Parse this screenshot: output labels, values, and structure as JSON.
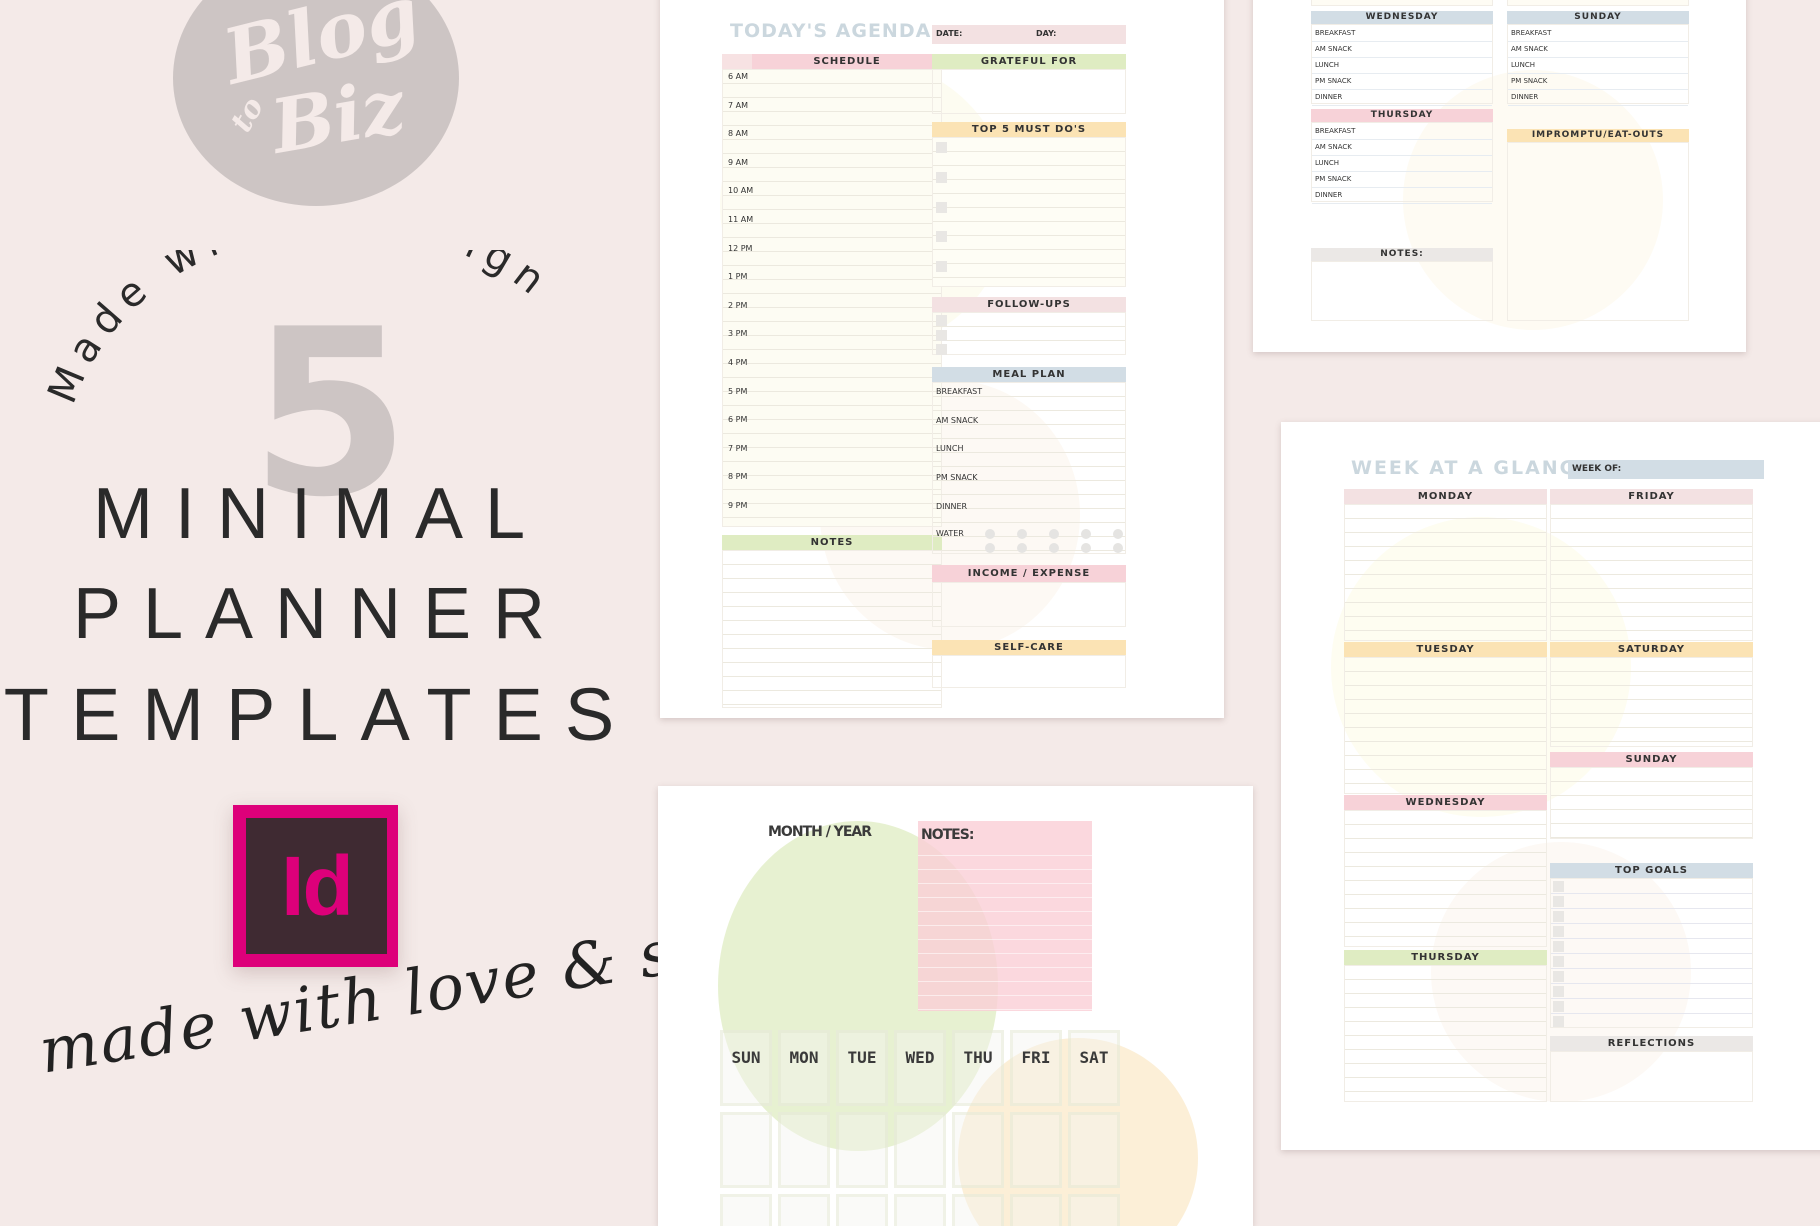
{
  "brand": {
    "logo_line1": "Blog",
    "logo_line2": "to",
    "logo_line3": "Biz"
  },
  "promo": {
    "arc_text": "Made with InDesign",
    "count": "5",
    "headline": [
      "MINIMAL",
      "PLANNER",
      "TEMPLATES"
    ],
    "app_icon_label": "Id",
    "tagline": "made with love & style"
  },
  "colors": {
    "background": "#f4eae8",
    "indesign_magenta": "#dd007a",
    "indesign_dark": "#3f2a32",
    "pink": "#f7d2d8",
    "green": "#dfecc2",
    "orange": "#fbe3b4",
    "blue": "#d2dde5",
    "grey": "#ebe8e6"
  },
  "agenda": {
    "title": "TODAY'S AGENDA",
    "date_label": "DATE:",
    "day_label": "DAY:",
    "schedule_header": "SCHEDULE",
    "times": [
      "6 AM",
      "7 AM",
      "8 AM",
      "9 AM",
      "10 AM",
      "11 AM",
      "12 PM",
      "1 PM",
      "2 PM",
      "3 PM",
      "4 PM",
      "5 PM",
      "6 PM",
      "7 PM",
      "8 PM",
      "9 PM"
    ],
    "notes_header": "NOTES",
    "grateful_header": "GRATEFUL FOR",
    "top5_header": "TOP 5 MUST DO'S",
    "followups_header": "FOLLOW-UPS",
    "meal_header": "MEAL PLAN",
    "meals": [
      "BREAKFAST",
      "AM SNACK",
      "LUNCH",
      "PM SNACK",
      "DINNER"
    ],
    "water_label": "WATER",
    "income_header": "INCOME / EXPENSE",
    "selfcare_header": "SELF-CARE"
  },
  "meal_planner": {
    "wednesday_header": "WEDNESDAY",
    "thursday_header": "THURSDAY",
    "sunday_header": "SUNDAY",
    "impromptu_header": "IMPROMPTU/EAT-OUTS",
    "notes_header": "NOTES:",
    "meals": [
      "BREAKFAST",
      "AM SNACK",
      "LUNCH",
      "PM SNACK",
      "DINNER"
    ]
  },
  "week": {
    "title": "WEEK AT A GLANCE",
    "week_of_label": "WEEK OF:",
    "days_left": [
      "MONDAY",
      "TUESDAY",
      "WEDNESDAY",
      "THURSDAY"
    ],
    "days_right": [
      "FRIDAY",
      "SATURDAY",
      "SUNDAY"
    ],
    "top_goals_header": "TOP GOALS",
    "reflections_header": "REFLECTIONS"
  },
  "month": {
    "month_year_label": "MONTH / YEAR",
    "notes_label": "NOTES:",
    "weekdays": [
      "SUN",
      "MON",
      "TUE",
      "WED",
      "THU",
      "FRI",
      "SAT"
    ]
  }
}
